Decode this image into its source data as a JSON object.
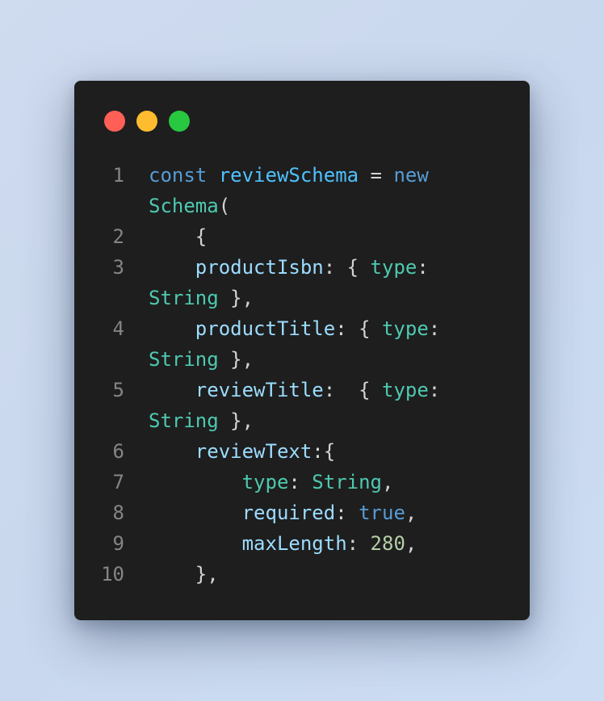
{
  "window": {
    "traffic_lights": [
      {
        "name": "close",
        "color": "#ff5f57"
      },
      {
        "name": "minimize",
        "color": "#febc2e"
      },
      {
        "name": "maximize",
        "color": "#28c840"
      }
    ]
  },
  "code": {
    "language": "javascript",
    "lines": [
      {
        "number": "1",
        "tokens": [
          {
            "t": "const",
            "c": "kw"
          },
          {
            "t": " ",
            "c": "punc"
          },
          {
            "t": "reviewSchema",
            "c": "var"
          },
          {
            "t": " = ",
            "c": "punc"
          },
          {
            "t": "new",
            "c": "kw"
          }
        ]
      },
      {
        "number": "",
        "tokens": [
          {
            "t": "Schema",
            "c": "type"
          },
          {
            "t": "(",
            "c": "punc"
          }
        ]
      },
      {
        "number": "2",
        "tokens": [
          {
            "t": "    {",
            "c": "punc"
          }
        ]
      },
      {
        "number": "3",
        "tokens": [
          {
            "t": "    ",
            "c": "punc"
          },
          {
            "t": "productIsbn",
            "c": "prop"
          },
          {
            "t": ": { ",
            "c": "punc"
          },
          {
            "t": "type",
            "c": "type"
          },
          {
            "t": ":",
            "c": "punc"
          }
        ]
      },
      {
        "number": "",
        "tokens": [
          {
            "t": "String",
            "c": "type"
          },
          {
            "t": " },",
            "c": "punc"
          }
        ]
      },
      {
        "number": "4",
        "tokens": [
          {
            "t": "    ",
            "c": "punc"
          },
          {
            "t": "productTitle",
            "c": "prop"
          },
          {
            "t": ": { ",
            "c": "punc"
          },
          {
            "t": "type",
            "c": "type"
          },
          {
            "t": ":",
            "c": "punc"
          }
        ]
      },
      {
        "number": "",
        "tokens": [
          {
            "t": "String",
            "c": "type"
          },
          {
            "t": " },",
            "c": "punc"
          }
        ]
      },
      {
        "number": "5",
        "tokens": [
          {
            "t": "    ",
            "c": "punc"
          },
          {
            "t": "reviewTitle",
            "c": "prop"
          },
          {
            "t": ":  { ",
            "c": "punc"
          },
          {
            "t": "type",
            "c": "type"
          },
          {
            "t": ":",
            "c": "punc"
          }
        ]
      },
      {
        "number": "",
        "tokens": [
          {
            "t": "String",
            "c": "type"
          },
          {
            "t": " },",
            "c": "punc"
          }
        ]
      },
      {
        "number": "6",
        "tokens": [
          {
            "t": "    ",
            "c": "punc"
          },
          {
            "t": "reviewText",
            "c": "prop"
          },
          {
            "t": ":{",
            "c": "punc"
          }
        ]
      },
      {
        "number": "7",
        "tokens": [
          {
            "t": "        ",
            "c": "punc"
          },
          {
            "t": "type",
            "c": "type"
          },
          {
            "t": ": ",
            "c": "punc"
          },
          {
            "t": "String",
            "c": "type"
          },
          {
            "t": ",",
            "c": "punc"
          }
        ]
      },
      {
        "number": "8",
        "tokens": [
          {
            "t": "        ",
            "c": "punc"
          },
          {
            "t": "required",
            "c": "prop"
          },
          {
            "t": ": ",
            "c": "punc"
          },
          {
            "t": "true",
            "c": "kw"
          },
          {
            "t": ",",
            "c": "punc"
          }
        ]
      },
      {
        "number": "9",
        "tokens": [
          {
            "t": "        ",
            "c": "punc"
          },
          {
            "t": "maxLength",
            "c": "prop"
          },
          {
            "t": ": ",
            "c": "punc"
          },
          {
            "t": "280",
            "c": "num"
          },
          {
            "t": ",",
            "c": "punc"
          }
        ]
      },
      {
        "number": "10",
        "tokens": [
          {
            "t": "    },",
            "c": "punc"
          }
        ]
      }
    ]
  },
  "colors": {
    "keyword": "#569cd6",
    "variable": "#4fc1ff",
    "property": "#9cdcfe",
    "type": "#4ec9b0",
    "number": "#b5cea8",
    "punctuation": "#d4d4d4",
    "line_number": "#858585",
    "editor_background": "#1e1e1e"
  }
}
